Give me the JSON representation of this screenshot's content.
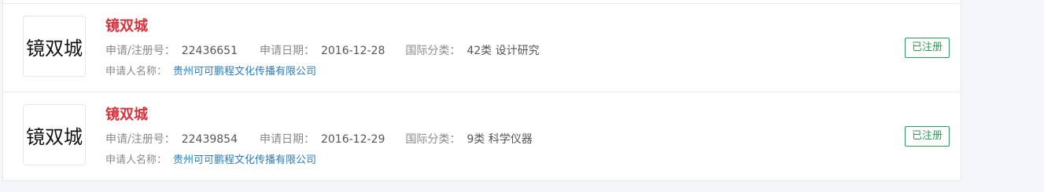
{
  "results": [
    {
      "logo_text": "镜双城",
      "name": "镜双城",
      "reg_no_label": "申请/注册号：",
      "reg_no": "22436651",
      "date_label": "申请日期：",
      "date": "2016-12-28",
      "class_label": "国际分类：",
      "class_value": "42类 设计研究",
      "applicant_label": "申请人名称：",
      "applicant": "贵州可可鹏程文化传播有限公司",
      "status": "已注册"
    },
    {
      "logo_text": "镜双城",
      "name": "镜双城",
      "reg_no_label": "申请/注册号：",
      "reg_no": "22439854",
      "date_label": "申请日期：",
      "date": "2016-12-29",
      "class_label": "国际分类：",
      "class_value": "9类 科学仪器",
      "applicant_label": "申请人名称：",
      "applicant": "贵州可可鹏程文化传播有限公司",
      "status": "已注册"
    }
  ],
  "colors": {
    "name": "#d8333c",
    "link": "#2a7bc0",
    "status": "#2e9a57"
  }
}
